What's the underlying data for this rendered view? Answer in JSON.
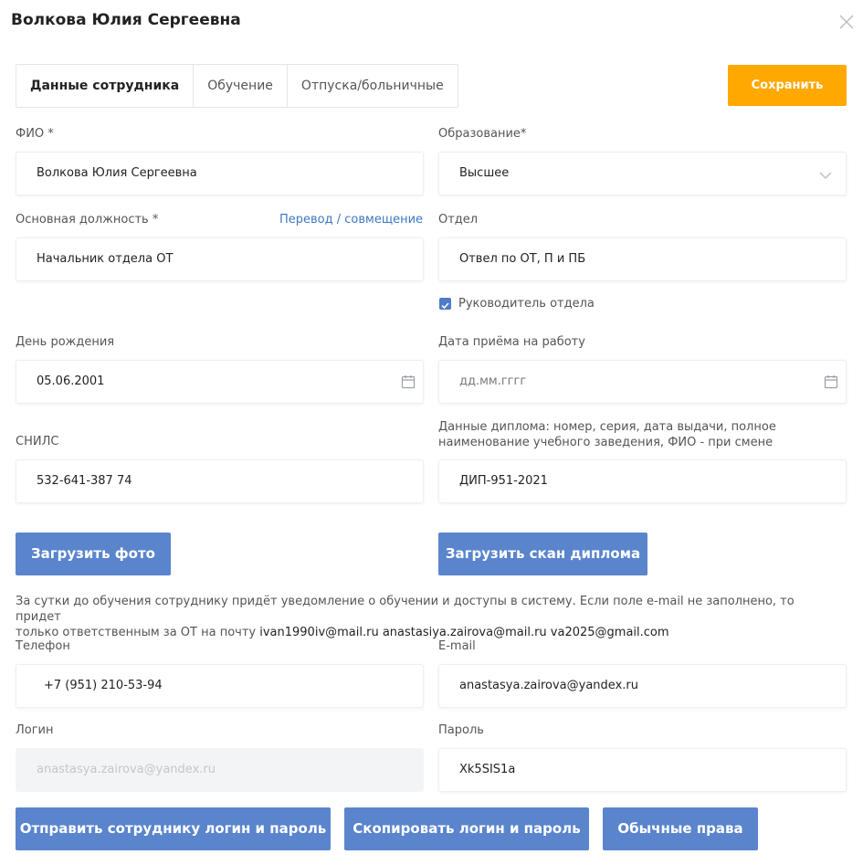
{
  "dialog": {
    "title": "Волкова Юлия Сергеевна"
  },
  "tabs": [
    {
      "label": "Данные сотрудника",
      "active": true
    },
    {
      "label": "Обучение",
      "active": false
    },
    {
      "label": "Отпуска/больничные",
      "active": false
    }
  ],
  "save_button": "Сохранить",
  "fio": {
    "label": "ФИО *",
    "value": "Волкова Юлия Сергеевна"
  },
  "education": {
    "label": "Образование*",
    "value": "Высшее"
  },
  "position": {
    "label": "Основная должность *",
    "link": "Перевод / совмещение",
    "value": "Начальник отдела ОТ"
  },
  "department": {
    "label": "Отдел",
    "value": "Отвел по ОТ, П и ПБ"
  },
  "head_checkbox": {
    "label": "Руководитель отдела",
    "checked": true
  },
  "birthday": {
    "label": "День рождения",
    "value": "05.06.2001"
  },
  "hire_date": {
    "label": "Дата приёма на работу",
    "placeholder": "дд.мм.гггг"
  },
  "snils": {
    "label": "СНИЛС",
    "value": "532-641-387 74"
  },
  "diploma": {
    "label_line1": "Данные диплома: номер, серия, дата выдачи, полное",
    "label_line2": "наименование учебного заведения, ФИО - при смене",
    "value": "ДИП-951-2021"
  },
  "upload_photo": "Загрузить фото",
  "upload_diploma": "Загрузить скан диплома",
  "notice": {
    "line1": "За сутки до обучения сотруднику придёт уведомление о обучении и доступы в систему. Если поле e-mail не заполнено, то придет",
    "line2_prefix": "только ответственным за ОТ на почту ",
    "emails": "ivan1990iv@mail.ru anastasiya.zairova@mail.ru va2025@gmail.com"
  },
  "phone": {
    "label": "Телефон",
    "value": "+7 (951) 210-53-94"
  },
  "email": {
    "label": "E-mail",
    "value": "anastasya.zairova@yandex.ru"
  },
  "login": {
    "label": "Логин",
    "value": "anastasya.zairova@yandex.ru"
  },
  "password": {
    "label": "Пароль",
    "value": "Xk5SIS1a"
  },
  "actions": {
    "send": "Отправить сотруднику логин и пароль",
    "copy": "Скопировать логин и пароль",
    "rights": "Обычные права"
  },
  "colors": {
    "accent_orange": "#ffa800",
    "button_blue": "#5a85cd",
    "link_blue": "#3d78c2"
  },
  "icons": [
    "close-icon",
    "chevron-down-icon",
    "calendar-icon",
    "checkbox-checked-icon"
  ]
}
